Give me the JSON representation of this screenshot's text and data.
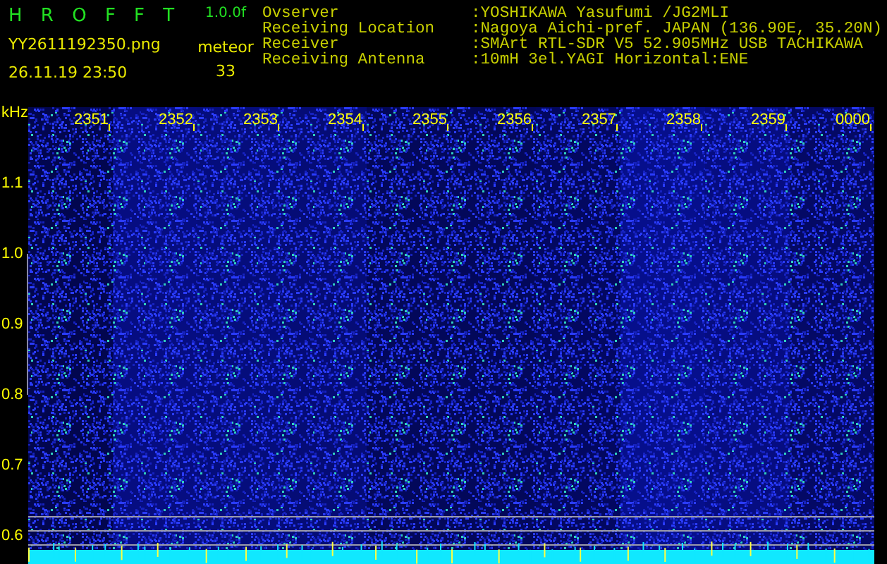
{
  "app": {
    "title": "H R O F F T",
    "version": "1.0.0f",
    "filename": "YY2611192350.png",
    "datetime": "26.11.19 23:50",
    "counter_label": "meteor",
    "counter_value": "33"
  },
  "station_info": [
    {
      "label": "Ovserver",
      "value": ":YOSHIKAWA Yasufumi /JG2MLI"
    },
    {
      "label": "Receiving Location",
      "value": ":Nagoya Aichi-pref. JAPAN (136.90E, 35.20N)"
    },
    {
      "label": "Receiver",
      "value": ":SMArt RTL-SDR V5 52.905MHz USB TACHIKAWA"
    },
    {
      "label": "Receiving Antenna",
      "value": ":10mH 3el.YAGI Horizontal:ENE"
    }
  ],
  "plot": {
    "unit": "kHz",
    "time_labels": [
      "2351",
      "2352",
      "2353",
      "2354",
      "2355",
      "2356",
      "2357",
      "2358",
      "2359",
      "0000"
    ],
    "frequency_labels": [
      "1.1",
      "1.0",
      "0.9",
      "0.8",
      "0.7",
      "0.6"
    ]
  }
}
